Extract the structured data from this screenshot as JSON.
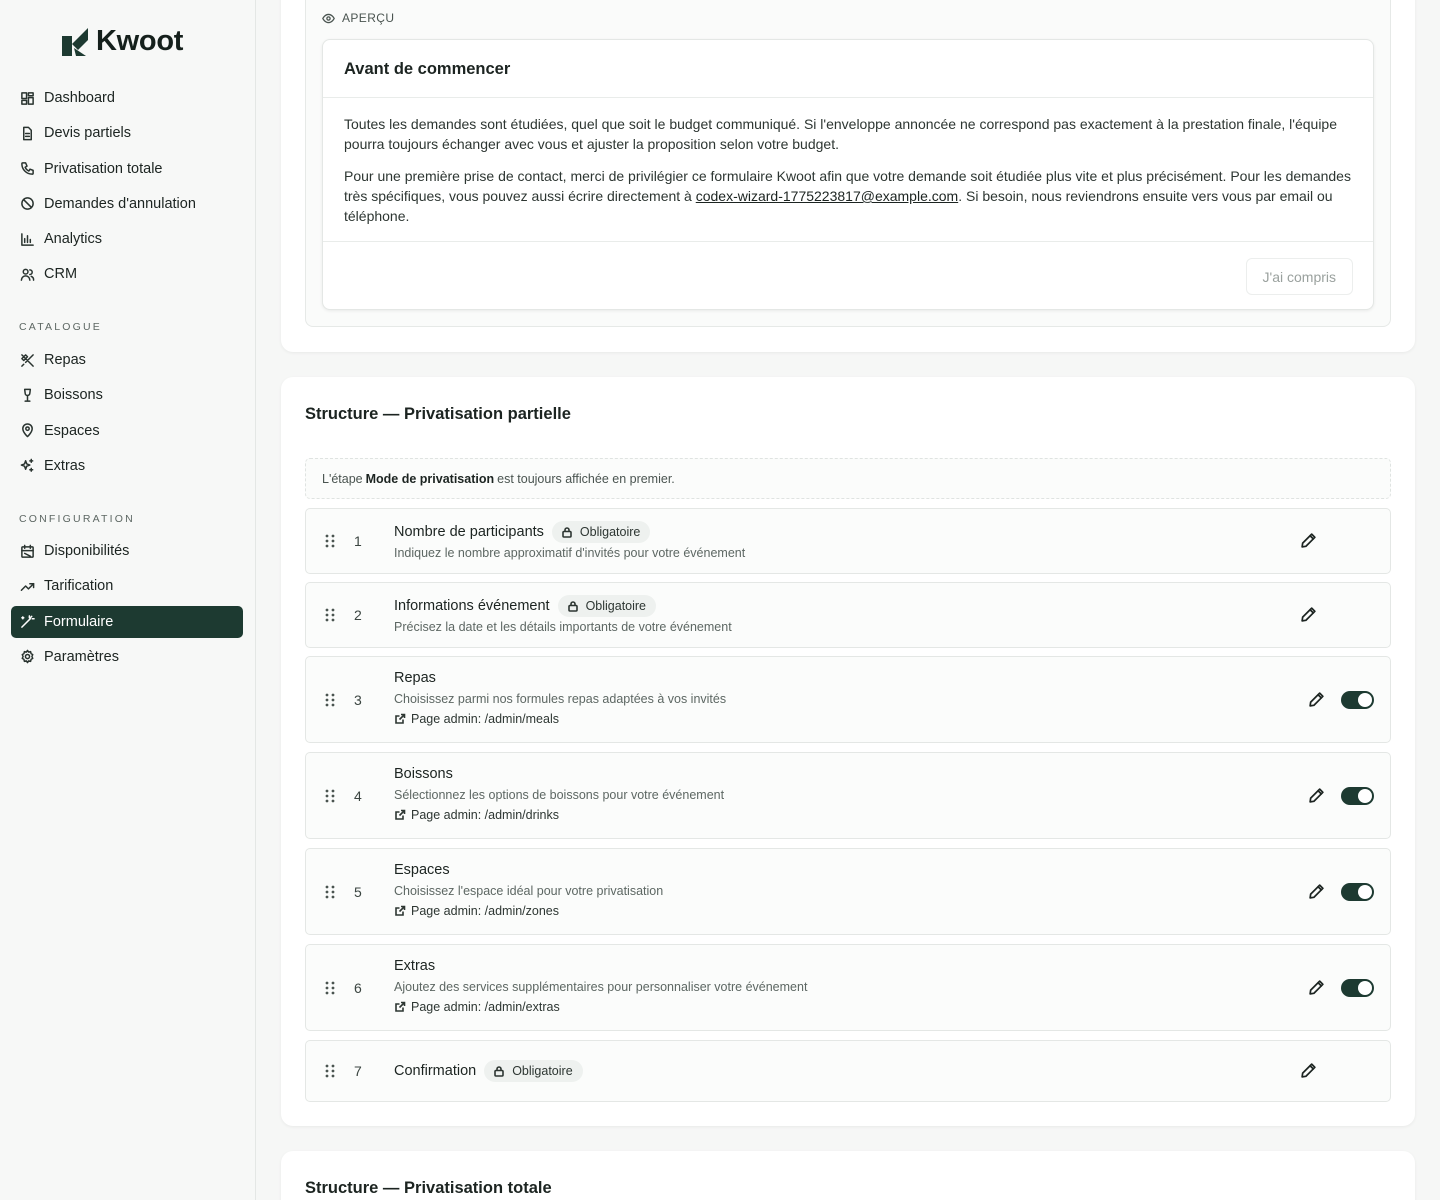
{
  "brand": {
    "name": "Kwoot"
  },
  "nav": {
    "main": [
      {
        "label": "Dashboard",
        "icon": "dashboard-icon"
      },
      {
        "label": "Devis partiels",
        "icon": "document-icon"
      },
      {
        "label": "Privatisation totale",
        "icon": "phone-icon"
      },
      {
        "label": "Demandes d'annulation",
        "icon": "ban-icon"
      },
      {
        "label": "Analytics",
        "icon": "bar-chart-icon"
      },
      {
        "label": "CRM",
        "icon": "users-icon"
      }
    ],
    "catalogue_label": "CATALOGUE",
    "catalogue": [
      {
        "label": "Repas",
        "icon": "utensils-icon"
      },
      {
        "label": "Boissons",
        "icon": "wine-icon"
      },
      {
        "label": "Espaces",
        "icon": "map-pin-icon"
      },
      {
        "label": "Extras",
        "icon": "sparkles-icon"
      }
    ],
    "configuration_label": "CONFIGURATION",
    "configuration": [
      {
        "label": "Disponibilités",
        "icon": "calendar-icon"
      },
      {
        "label": "Tarification",
        "icon": "trending-up-icon"
      },
      {
        "label": "Formulaire",
        "icon": "wand-icon",
        "active": true
      },
      {
        "label": "Paramètres",
        "icon": "gear-icon"
      }
    ]
  },
  "preview": {
    "label": "APERÇU",
    "modal_title": "Avant de commencer",
    "paragraph1": "Toutes les demandes sont étudiées, quel que soit le budget communiqué. Si l'enveloppe annoncée ne correspond pas exactement à la prestation finale, l'équipe pourra toujours échanger avec vous et ajuster la proposition selon votre budget.",
    "paragraph2_before": "Pour une première prise de contact, merci de privilégier ce formulaire Kwoot afin que votre demande soit étudiée plus vite et plus précisément. Pour les demandes très spécifiques, vous pouvez aussi écrire directement à ",
    "email": "codex-wizard-1775223817@example.com",
    "paragraph2_after": ". Si besoin, nous reviendrons ensuite vers vous par email ou téléphone.",
    "button": "J'ai compris"
  },
  "structure_partial": {
    "title": "Structure — Privatisation partielle",
    "note_before": "L'étape",
    "note_bold": "Mode de privatisation",
    "note_after": "est toujours affichée en premier.",
    "steps": [
      {
        "num": "1",
        "title": "Nombre de participants",
        "badge": "Obligatoire",
        "desc": "Indiquez le nombre approximatif d'invités pour votre événement"
      },
      {
        "num": "2",
        "title": "Informations événement",
        "badge": "Obligatoire",
        "desc": "Précisez la date et les détails importants de votre événement"
      },
      {
        "num": "3",
        "title": "Repas",
        "desc": "Choisissez parmi nos formules repas adaptées à vos invités",
        "link": "Page admin: /admin/meals",
        "enabled": true
      },
      {
        "num": "4",
        "title": "Boissons",
        "desc": "Sélectionnez les options de boissons pour votre événement",
        "link": "Page admin: /admin/drinks",
        "enabled": true
      },
      {
        "num": "5",
        "title": "Espaces",
        "desc": "Choisissez l'espace idéal pour votre privatisation",
        "link": "Page admin: /admin/zones",
        "enabled": true
      },
      {
        "num": "6",
        "title": "Extras",
        "desc": "Ajoutez des services supplémentaires pour personnaliser votre événement",
        "link": "Page admin: /admin/extras",
        "enabled": true
      },
      {
        "num": "7",
        "title": "Confirmation",
        "badge": "Obligatoire"
      }
    ]
  },
  "structure_total": {
    "title": "Structure — Privatisation totale"
  },
  "colors": {
    "primary": "#1d3a31",
    "background": "#f6f7f6"
  }
}
